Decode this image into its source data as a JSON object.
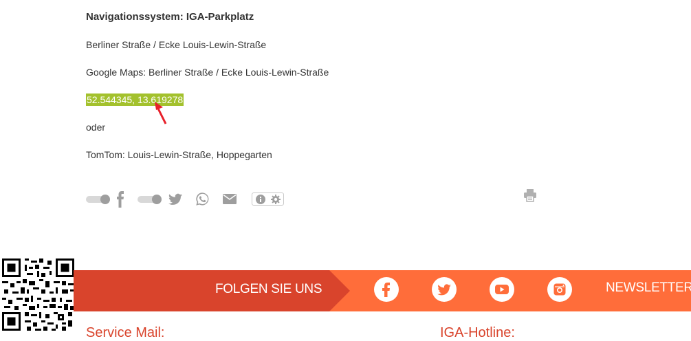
{
  "article": {
    "heading": "Navigationssystem: IGA-Parkplatz",
    "address": "Berliner Straße / Ecke Louis-Lewin-Straße",
    "google_maps": "Google Maps: Berliner Straße / Ecke Louis-Lewin-Straße",
    "coordinates": "52.544345, 13.619278",
    "or_text": "oder",
    "tomtom": "TomTom: Louis-Lewin-Straße, Hoppegarten"
  },
  "share": {
    "icons": [
      "toggle-icon",
      "facebook-icon",
      "toggle-icon",
      "twitter-icon",
      "whatsapp-icon",
      "mail-icon",
      "info-icon",
      "gear-icon",
      "print-icon"
    ]
  },
  "footer": {
    "follow_label": "FOLGEN SIE UNS",
    "newsletter_label": "NEWSLETTER",
    "service_mail": "Service Mail:",
    "hotline": "IGA-Hotline:",
    "colors": {
      "dark": "#d9442c",
      "light": "#ff6d3a",
      "highlight": "#a3c12d"
    },
    "socials": [
      "facebook-icon",
      "twitter-icon",
      "youtube-icon",
      "instagram-icon"
    ]
  }
}
